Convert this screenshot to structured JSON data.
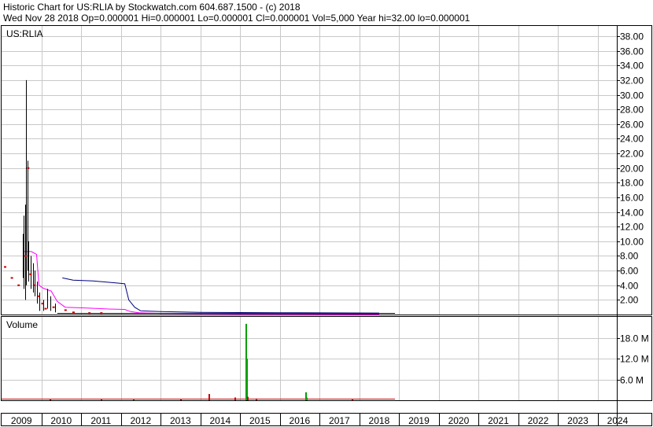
{
  "header": {
    "line1": "Historic Chart for US:RLIA by Stockwatch.com 604.687.1500 - (c) 2018",
    "line2": "Wed Nov 28 2018   Op=0.000001   Hi=0.000001   Lo=0.000001   Cl=0.000001   Vol=5,000   Year hi=32.00   lo=0.000001"
  },
  "chart_data": [
    {
      "type": "line",
      "panel": "price",
      "title": "US:RLIA",
      "ylim": [
        0,
        39.4
      ],
      "y_ticks": [
        "2.00",
        "4.00",
        "6.00",
        "8.00",
        "10.00",
        "12.00",
        "14.00",
        "16.00",
        "18.00",
        "20.00",
        "22.00",
        "24.00",
        "26.00",
        "28.00",
        "30.00",
        "32.00",
        "34.00",
        "36.00",
        "38.00"
      ],
      "grid": true,
      "price_bars": [
        {
          "x": 2009.53,
          "lo": 5.0,
          "hi": 11.0
        },
        {
          "x": 2009.56,
          "lo": 3.5,
          "hi": 13.5
        },
        {
          "x": 2009.59,
          "lo": 2.0,
          "hi": 15.0
        },
        {
          "x": 2009.62,
          "lo": 4.0,
          "hi": 32.0
        },
        {
          "x": 2009.65,
          "lo": 6.0,
          "hi": 21.0
        },
        {
          "x": 2009.68,
          "lo": 4.5,
          "hi": 10.0
        },
        {
          "x": 2009.73,
          "lo": 3.5,
          "hi": 8.0
        },
        {
          "x": 2009.79,
          "lo": 3.0,
          "hi": 7.0
        },
        {
          "x": 2009.84,
          "lo": 2.5,
          "hi": 6.0
        },
        {
          "x": 2009.9,
          "lo": 1.5,
          "hi": 4.5
        },
        {
          "x": 2009.96,
          "lo": 0.5,
          "hi": 3.0
        },
        {
          "x": 2010.05,
          "lo": 0.5,
          "hi": 2.0
        },
        {
          "x": 2010.15,
          "lo": 0.8,
          "hi": 3.5
        },
        {
          "x": 2010.22,
          "lo": 0.5,
          "hi": 2.5
        },
        {
          "x": 2010.35,
          "lo": 0.3,
          "hi": 1.5
        }
      ],
      "closes": [
        {
          "x": 2009.08,
          "y": 6.5
        },
        {
          "x": 2009.25,
          "y": 5.0
        },
        {
          "x": 2009.42,
          "y": 4.0
        },
        {
          "x": 2009.6,
          "y": 8.0
        },
        {
          "x": 2009.66,
          "y": 20.0
        },
        {
          "x": 2009.72,
          "y": 5.5
        },
        {
          "x": 2009.82,
          "y": 4.0
        },
        {
          "x": 2009.92,
          "y": 2.5
        },
        {
          "x": 2010.02,
          "y": 1.5
        },
        {
          "x": 2010.1,
          "y": 0.8
        },
        {
          "x": 2010.3,
          "y": 1.0
        },
        {
          "x": 2010.6,
          "y": 0.6
        },
        {
          "x": 2010.8,
          "y": 0.3
        },
        {
          "x": 2011.2,
          "y": 0.2
        },
        {
          "x": 2011.5,
          "y": 0.2
        }
      ],
      "series": [
        {
          "color": "#ff00ff",
          "points": [
            [
              2009.55,
              8.6
            ],
            [
              2009.75,
              8.6
            ],
            [
              2009.88,
              8.2
            ],
            [
              2009.94,
              4.0
            ],
            [
              2010.05,
              3.6
            ],
            [
              2010.25,
              3.2
            ],
            [
              2010.4,
              1.8
            ],
            [
              2010.6,
              1.0
            ],
            [
              2011.1,
              0.9
            ],
            [
              2011.7,
              0.75
            ],
            [
              2012.1,
              0.7
            ],
            [
              2012.25,
              0.4
            ],
            [
              2012.45,
              0.25
            ],
            [
              2013.0,
              0.15
            ],
            [
              2015.0,
              0.1
            ],
            [
              2018.5,
              0.05
            ]
          ]
        },
        {
          "color": "#000080",
          "points": [
            [
              2010.53,
              5.0
            ],
            [
              2010.8,
              4.7
            ],
            [
              2011.3,
              4.6
            ],
            [
              2011.9,
              4.3
            ],
            [
              2012.1,
              4.2
            ],
            [
              2012.2,
              2.0
            ],
            [
              2012.35,
              1.0
            ],
            [
              2012.5,
              0.5
            ],
            [
              2013.0,
              0.4
            ],
            [
              2014.0,
              0.3
            ],
            [
              2016.0,
              0.25
            ],
            [
              2018.5,
              0.2
            ]
          ]
        }
      ]
    },
    {
      "type": "bar",
      "panel": "volume",
      "title": "Volume",
      "ylim": [
        0,
        24
      ],
      "y_ticks": [
        "6.0 M",
        "12.0 M",
        "18.0 M"
      ],
      "bars": [
        {
          "x": 2014.2,
          "value": 1.8,
          "color": "#cc0000"
        },
        {
          "x": 2014.85,
          "value": 0.8,
          "color": "#cc0000"
        },
        {
          "x": 2015.13,
          "value": 22.0,
          "color": "#00a000"
        },
        {
          "x": 2015.15,
          "value": 12.0,
          "color": "#00a000"
        },
        {
          "x": 2015.18,
          "value": 1.0,
          "color": "#cc0000"
        },
        {
          "x": 2015.4,
          "value": 0.5,
          "color": "#cc0000"
        },
        {
          "x": 2016.64,
          "value": 2.3,
          "color": "#00a000"
        },
        {
          "x": 2016.67,
          "value": 0.8,
          "color": "#00a000"
        },
        {
          "x": 2013.5,
          "value": 0.3,
          "color": "#cc0000"
        },
        {
          "x": 2012.3,
          "value": 0.3,
          "color": "#00a000"
        },
        {
          "x": 2011.5,
          "value": 0.2,
          "color": "#cc0000"
        },
        {
          "x": 2010.2,
          "value": 0.3,
          "color": "#cc0000"
        },
        {
          "x": 2017.8,
          "value": 0.2,
          "color": "#cc0000"
        }
      ]
    }
  ],
  "x_axis": {
    "labels": [
      {
        "x": 2009.0,
        "label": "2009"
      },
      {
        "x": 2010.0,
        "label": "2010"
      },
      {
        "x": 2011.0,
        "label": "2011"
      },
      {
        "x": 2012.0,
        "label": "2012"
      },
      {
        "x": 2013.0,
        "label": "2013"
      },
      {
        "x": 2014.0,
        "label": "2014"
      },
      {
        "x": 2015.0,
        "label": "2015"
      },
      {
        "x": 2016.0,
        "label": "2016"
      },
      {
        "x": 2017.0,
        "label": "2017"
      },
      {
        "x": 2018.0,
        "label": "2018"
      },
      {
        "x": 2019.0,
        "label": "2019"
      },
      {
        "x": 2020.0,
        "label": "2020"
      },
      {
        "x": 2021.0,
        "label": "2021"
      },
      {
        "x": 2022.0,
        "label": "2022"
      },
      {
        "x": 2023.0,
        "label": "2023"
      },
      {
        "x": 2024.0,
        "label": "2024"
      }
    ]
  }
}
